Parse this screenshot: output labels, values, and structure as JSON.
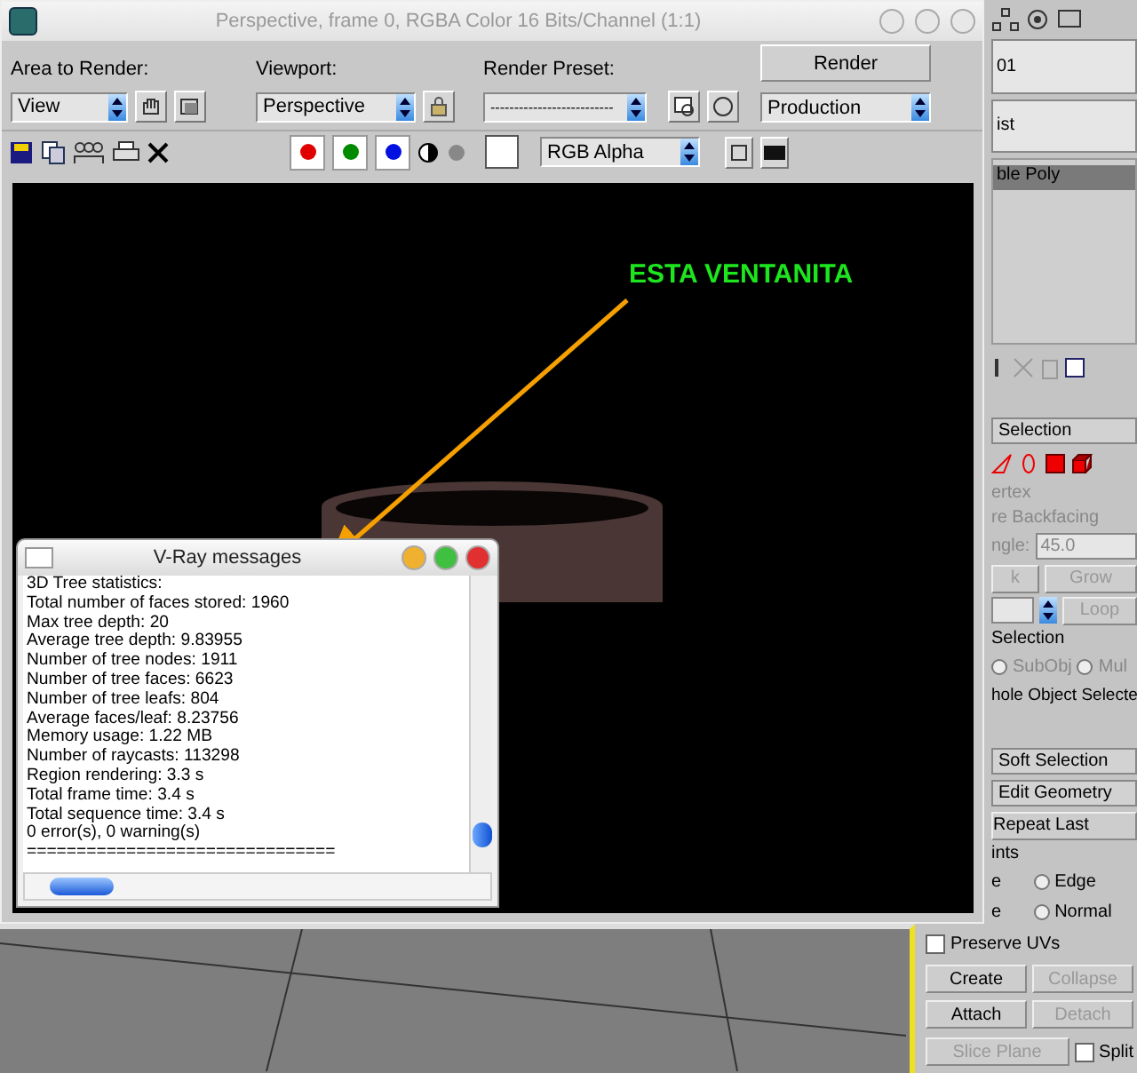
{
  "render_window": {
    "title": "Perspective, frame 0, RGBA Color 16 Bits/Channel (1:1)",
    "area_label": "Area to Render:",
    "area_value": "View",
    "viewport_label": "Viewport:",
    "viewport_value": "Perspective",
    "preset_label": "Render Preset:",
    "preset_value": "--------------------------",
    "render_button": "Render",
    "production_value": "Production",
    "channels": [
      {
        "color": "#e00000"
      },
      {
        "color": "#008a00"
      },
      {
        "color": "#0010e0"
      }
    ],
    "display_value": "RGB Alpha"
  },
  "annotation": {
    "text": "ESTA VENTANITA"
  },
  "vray_messages": {
    "title": "V-Ray messages",
    "lines": [
      "3D Tree statistics:",
      "Total number of faces stored: 1960",
      "Max tree depth: 20",
      "Average tree depth: 9.83955",
      "Number of tree nodes: 1911",
      "Number of tree faces: 6623",
      "Number of tree leafs: 804",
      "Average faces/leaf: 8.23756",
      "Memory usage: 1.22 MB",
      "Number of raycasts: 113298",
      "Region rendering: 3.3 s",
      "Total frame time: 3.4 s",
      "Total sequence time: 3.4 s",
      "0 error(s), 0 warning(s)",
      "==============================="
    ]
  },
  "command_panel": {
    "name_value": "01",
    "list_label": "ist",
    "modifier_item": {
      "label": "ble Poly",
      "selected": true
    },
    "selection_rollout": "Selection",
    "vertex_label": "ertex",
    "backfacing_label": "re Backfacing",
    "angle_label": "ngle:",
    "angle_value": "45.0",
    "buttons_row1": [
      "k",
      "Grow"
    ],
    "loop_button": "Loop",
    "preview_group": "Selection",
    "preview_options": [
      {
        "label": "SubObj",
        "selected": false
      },
      {
        "label": "Mul",
        "selected": false
      }
    ],
    "whole_object_text": "hole Object Selecte",
    "rollouts": [
      "Soft Selection",
      "Edit Geometry"
    ],
    "repeat_last": "Repeat Last",
    "constraints_group": "ints",
    "constraint_options": [
      {
        "prefix": "e",
        "label": "Edge",
        "selected": false
      },
      {
        "prefix": "e",
        "label": "Normal",
        "selected": false
      }
    ],
    "preserve_uvs": {
      "label": "Preserve UVs",
      "checked": false
    },
    "create_button": "Create",
    "collapse_button": "Collapse",
    "attach_button": "Attach",
    "detach_button": "Detach",
    "slice_plane_button": "Slice Plane",
    "split": {
      "label": "Split",
      "checked": false
    }
  }
}
